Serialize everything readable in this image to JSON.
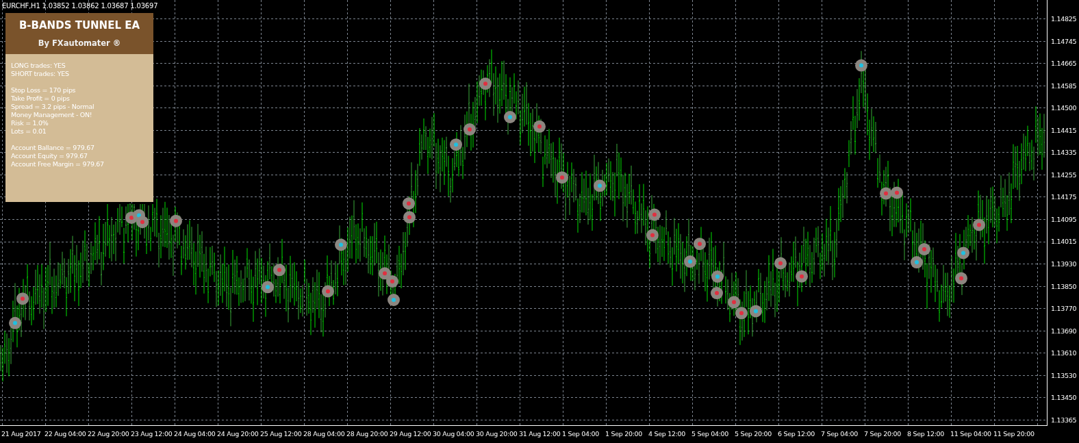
{
  "chart_header": {
    "symbol": "EURCHF,H1",
    "quote": "1.03852 1.03862 1.03687 1.03697"
  },
  "info_panel": {
    "title": "B-BANDS TUNNEL EA",
    "subtitle": "By FXautomater ®",
    "groups": [
      [
        "LONG trades: YES",
        "SHORT trades: YES"
      ],
      [
        "Stop Loss = 170 pips",
        "Take Profit = 0 pips",
        "Spread = 3.2 pips - Normal",
        "Money Management - ON!",
        "Risk = 1.0%",
        "Lots = 0.01"
      ],
      [
        "Account Ballance = 979.67",
        "Account Equity = 979.67",
        "Account Free Margin = 979.67"
      ]
    ]
  },
  "price_axis": [
    "1.14825",
    "1.14745",
    "1.14665",
    "1.14585",
    "1.14500",
    "1.14415",
    "1.14335",
    "1.14255",
    "1.14175",
    "1.14095",
    "1.14015",
    "1.13930",
    "1.13850",
    "1.13770",
    "1.13690",
    "1.13610",
    "1.13530",
    "1.13450",
    "1.13365"
  ],
  "time_axis": [
    "21 Aug 2017",
    "22 Aug 04:00",
    "22 Aug 20:00",
    "23 Aug 12:00",
    "24 Aug 04:00",
    "24 Aug 20:00",
    "25 Aug 12:00",
    "28 Aug 04:00",
    "28 Aug 20:00",
    "29 Aug 12:00",
    "30 Aug 04:00",
    "30 Aug 20:00",
    "31 Aug 12:00",
    "1 Sep 04:00",
    "1 Sep 20:00",
    "4 Sep 12:00",
    "5 Sep 04:00",
    "5 Sep 20:00",
    "6 Sep 12:00",
    "7 Sep 04:00",
    "7 Sep 20:00",
    "8 Sep 12:00",
    "11 Sep 04:00",
    "11 Sep 20:00"
  ]
}
